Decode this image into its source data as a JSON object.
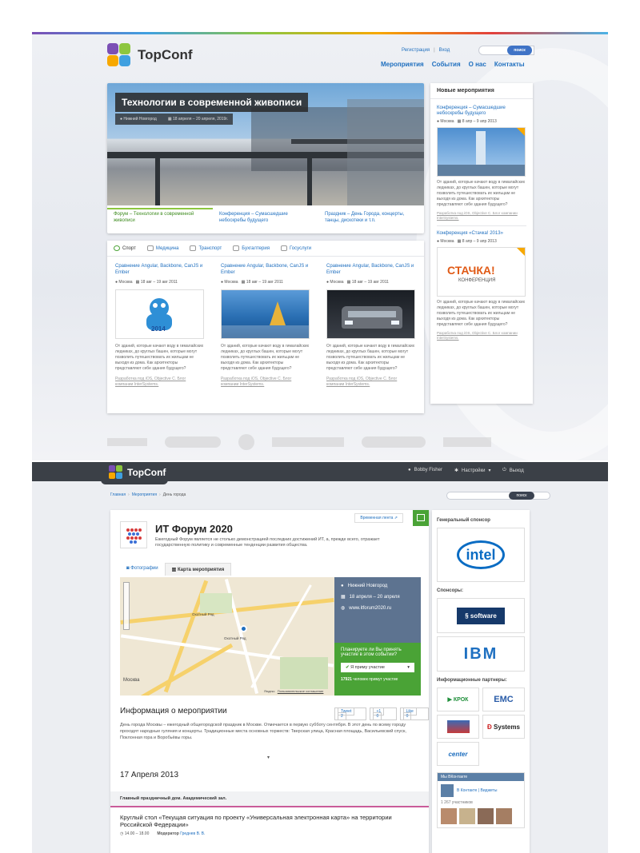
{
  "colors": {
    "brand_blue": "#1f6fbf",
    "green": "#4aa336",
    "slate": "#5d7390",
    "dark_bar": "#3b4047"
  },
  "page1": {
    "logo_text": "TopConf",
    "top_links": [
      "Регистрация",
      "|",
      "Вход"
    ],
    "search_button": "поиск",
    "nav": [
      "Мероприятия",
      "События",
      "О нас",
      "Контакты"
    ],
    "hero": {
      "title": "Технологии в современной живописи",
      "city": "Нижний Новгород",
      "dates": "18 апреля – 20 апреля, 2019г.",
      "links": [
        "Форум – Технологии в современной живописи",
        "Конференция – Сумасшедшие небоскребы будущего",
        "Праздник – День Города, концерты, танцы, дискотеки и т.п."
      ]
    },
    "tabs": [
      "Спорт",
      "Медицина",
      "Транспорт",
      "Бухгалтерия",
      "Госуслуги"
    ],
    "cards": [
      {
        "title": "Сравнение Angular, Backbone, CanJS и Ember",
        "city": "Москва",
        "dates": "18 авг – 19 авг 2011",
        "desc": "От зданий, которые качают воду в гималайских ледниках, до круглых башен, которые могут позволить путешествовать их жильцам не выходя из дома. Как архитекторы представляют себе здания будущего?",
        "footer": "Разработка под iOS, Objective C. Блог компании InterSystems."
      },
      {
        "title": "Сравнение Angular, Backbone, CanJS и Ember",
        "city": "Москва",
        "dates": "18 авг – 19 авг 2011",
        "desc": "От зданий, которые качают воду в гималайских ледниках, до круглых башен, которые могут позволить путешествовать их жильцам не выходя из дома. Как архитекторы представляют себе здания будущего?",
        "footer": "Разработка под iOS, Objective C. Блог компании InterSystems."
      },
      {
        "title": "Сравнение Angular, Backbone, CanJS и Ember",
        "city": "Москва",
        "dates": "18 авг – 19 авг 2011",
        "desc": "От зданий, которые качают воду в гималайских ледниках, до круглых башен, которые могут позволить путешествовать их жильцам не выходя из дома. Как архитекторы представляют себе здания будущего?",
        "footer": "Разработка под iOS, Objective C. Блог компании InterSystems."
      }
    ],
    "sidebar": {
      "title": "Новые мероприятия",
      "items": [
        {
          "title": "Конференция – Сумасшедшие небоскребы будущего",
          "city": "Москва",
          "dates": "8 апр – 9 апр 2013",
          "desc": "От зданий, которые качают воду в гималайских ледниках, до круглых башен, которые могут позволить путешествовать их жильцам не выходя из дома. Как архитекторы представляют себе здания будущего?",
          "footer": "Разработка под iOS, Objective C. Блог компании InterSystems."
        },
        {
          "title": "Конференция «Стачка! 2013»",
          "city": "Москва",
          "dates": "8 апр – 9 апр 2013",
          "img_text_main": "СТАЧКА!",
          "img_text_sub": "КОНФЕРЕНЦИЯ",
          "desc": "От зданий, которые качают воду в гималайских ледниках, до круглых башен, которые могут позволить путешествовать их жильцам не выходя из дома. Как архитекторы представляют себе здания будущего?",
          "footer": "Разработка под iOS, Objective C. Блог компании InterSystems."
        }
      ]
    },
    "card_img_label": "2014"
  },
  "page2": {
    "logo_text": "TopConf",
    "user": "Bobby Fisher",
    "settings": "Настройки",
    "logout": "Выход",
    "breadcrumb": [
      "Главная",
      "›",
      "Мероприятия",
      "›",
      "День города"
    ],
    "timeline_link": "Временная лента",
    "event_title": "ИТ Форум 2020",
    "event_desc": "Ежегодный Форум является не столько демонстрацией последних достижений ИТ, а, прежде всего, отражает государственную политику и современные тенденции развития общества.",
    "tabs": [
      "Фотографии",
      "Карта мероприятия"
    ],
    "map_labels": [
      "Охотный Ряд",
      "Охотный Ряд",
      "Москва",
      "Яндекс",
      "Пользовательское соглашение"
    ],
    "info": {
      "city": "Нижний Новгород",
      "dates": "18 апреля – 20 апреля",
      "site": "www.itforum2020.ru",
      "question": "Планируете ли Вы принять участие в этом событии?",
      "attend_label": "Я приму участие",
      "count": "17921",
      "count_suffix": "человек примут участие"
    },
    "info_title": "Информация о мероприятии",
    "social": [
      {
        "label": "Tweet",
        "count": "2"
      },
      {
        "label": "+1",
        "count": "0"
      },
      {
        "label": "Like",
        "count": "0"
      }
    ],
    "info_text": "День города Москвы – ежегодный общегородской праздник в Москве. Отмечается в первую субботу сентября. В этот день по всему городу проходят народные гуляния и концерты. Традиционные места основных торжеств: Тверская улица, Красная площадь, Васильевский спуск, Поклонная гора и Воробьёвы горы.",
    "date_heading": "17 Апреля 2013",
    "venue": "Главный праздничный дом. Академический зал.",
    "session_title": "Круглый стол «Текущая ситуация по проекту «Универсальная электронная карта» на территории Российской Федерации»",
    "session_time": "14.00 – 18.00",
    "moderator_label": "Модератор",
    "moderator": "Греднев В. В.",
    "sidebar": {
      "general_sponsor": "Генеральный спонсор",
      "sponsors": "Спонсоры:",
      "partners": "Информационные партнеры:",
      "logos": {
        "intel": "intel",
        "software": "software",
        "ibm": "IBM",
        "krok": "КРОК",
        "emc": "EMC",
        "systems": "Systems",
        "center": "center"
      },
      "vk_title": "Мы ВКонтакте",
      "vk_group": "В Контакте | Виджеты",
      "vk_members": "1 267 участников"
    }
  }
}
